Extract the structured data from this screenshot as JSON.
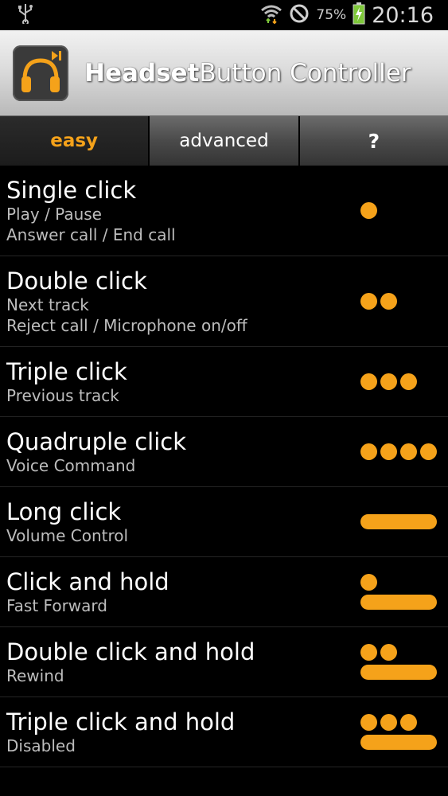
{
  "status": {
    "battery": "75%",
    "time": "20:16",
    "icons": [
      "usb-icon",
      "wifi-icon",
      "blocked-icon",
      "battery-charging-icon"
    ]
  },
  "header": {
    "title_bold": "Headset",
    "title_rest": "Button Controller",
    "icon": "headphones-play-icon"
  },
  "tabs": [
    {
      "label": "easy",
      "active": true
    },
    {
      "label": "advanced",
      "active": false
    },
    {
      "label": "?",
      "active": false
    }
  ],
  "colors": {
    "accent": "#f5a21a",
    "background": "#000000"
  },
  "rows": [
    {
      "title": "Single click",
      "sub1": "Play / Pause",
      "sub2": "Answer call / End call",
      "dots": 1,
      "bar": false
    },
    {
      "title": "Double click",
      "sub1": "Next track",
      "sub2": "Reject call / Microphone on/off",
      "dots": 2,
      "bar": false
    },
    {
      "title": "Triple click",
      "sub1": "Previous track",
      "sub2": "",
      "dots": 3,
      "bar": false
    },
    {
      "title": "Quadruple click",
      "sub1": "Voice Command",
      "sub2": "",
      "dots": 4,
      "bar": false
    },
    {
      "title": "Long click",
      "sub1": "Volume Control",
      "sub2": "",
      "dots": 0,
      "bar": true
    },
    {
      "title": "Click and hold",
      "sub1": "Fast Forward",
      "sub2": "",
      "dots": 1,
      "bar": true
    },
    {
      "title": "Double click and hold",
      "sub1": "Rewind",
      "sub2": "",
      "dots": 2,
      "bar": true
    },
    {
      "title": "Triple click and hold",
      "sub1": "Disabled",
      "sub2": "",
      "dots": 3,
      "bar": true
    }
  ]
}
